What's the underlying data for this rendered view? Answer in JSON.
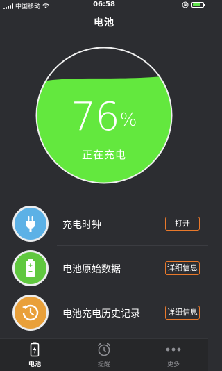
{
  "status_bar": {
    "carrier": "中国移动",
    "time": "06:58",
    "battery_level": 0.76
  },
  "nav": {
    "title": "电池"
  },
  "gauge": {
    "level": 0.76,
    "percent": "76",
    "unit": "%",
    "status": "正在充电",
    "fill_color": "#63e83e"
  },
  "list": [
    {
      "label": "充电时钟",
      "button": "打开",
      "icon": "plug-icon",
      "color": "#5cb1e6"
    },
    {
      "label": "电池原始数据",
      "button": "详细信息",
      "icon": "battery-icon",
      "color": "#60c83f"
    },
    {
      "label": "电池充电历史记录",
      "button": "详细信息",
      "icon": "history-clock-icon",
      "color": "#e9a03a"
    }
  ],
  "tabbar": {
    "tabs": [
      {
        "label": "电池",
        "icon": "battery-tab-icon",
        "active": true
      },
      {
        "label": "提醒",
        "icon": "alarm-clock-icon",
        "active": false
      },
      {
        "label": "更多",
        "icon": "more-dots-icon",
        "active": false
      }
    ]
  },
  "colors": {
    "accent": "#e9792b",
    "background": "#2c2d31"
  }
}
